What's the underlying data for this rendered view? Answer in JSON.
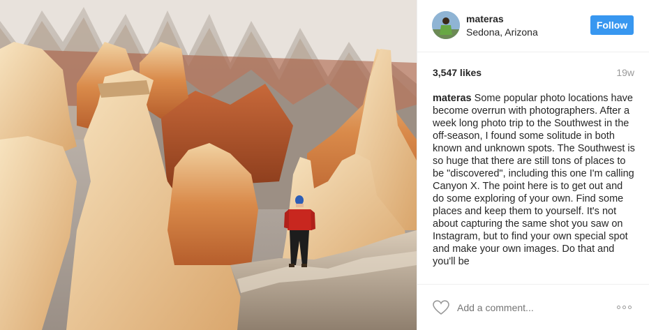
{
  "post": {
    "username": "materas",
    "location": "Sedona, Arizona",
    "follow_label": "Follow",
    "likes": "3,547 likes",
    "age": "19w",
    "caption_user": "materas",
    "caption_text": "Some popular photo locations have become overrun with photographers. After a week long photo trip to the Southwest in the off-season, I found some solitude in both known and unknown spots. The Southwest is so huge that there are still tons of places to be \"discovered\", including this one I'm calling Canyon X. The point here is to get out and do some exploring of your own. Find some places and keep them to yourself. It's not about capturing the same shot you saw on Instagram, but to find your own special spot and make your own images. Do that and you'll be"
  },
  "comment": {
    "placeholder": "Add a comment..."
  },
  "icons": {
    "like": "heart-icon",
    "more": "more-options-icon"
  },
  "colors": {
    "follow_button": "#3897f0",
    "muted_text": "#999999"
  }
}
